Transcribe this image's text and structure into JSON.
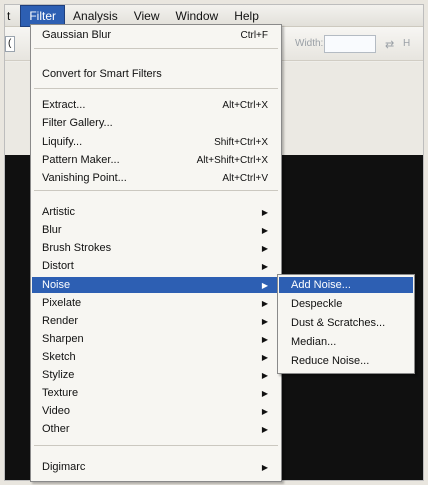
{
  "menubar": {
    "left_cut": "t",
    "items": [
      "Filter",
      "Analysis",
      "View",
      "Window",
      "Help"
    ],
    "active_index": 0
  },
  "optbar": {
    "left_cut": "(",
    "width_label": "Width:",
    "swap_glyph": "⇄",
    "right_cut": "H"
  },
  "menu": {
    "gaussian_blur": {
      "label": "Gaussian Blur",
      "shortcut": "Ctrl+F"
    },
    "convert_smart": {
      "label": "Convert for Smart Filters"
    },
    "extract": {
      "label": "Extract...",
      "shortcut": "Alt+Ctrl+X"
    },
    "filter_gallery": {
      "label": "Filter Gallery..."
    },
    "liquify": {
      "label": "Liquify...",
      "shortcut": "Shift+Ctrl+X"
    },
    "pattern_maker": {
      "label": "Pattern Maker...",
      "shortcut": "Alt+Shift+Ctrl+X"
    },
    "vanishing_point": {
      "label": "Vanishing Point...",
      "shortcut": "Alt+Ctrl+V"
    },
    "artistic": {
      "label": "Artistic"
    },
    "blur": {
      "label": "Blur"
    },
    "brush_strokes": {
      "label": "Brush Strokes"
    },
    "distort": {
      "label": "Distort"
    },
    "noise": {
      "label": "Noise"
    },
    "pixelate": {
      "label": "Pixelate"
    },
    "render": {
      "label": "Render"
    },
    "sharpen": {
      "label": "Sharpen"
    },
    "sketch": {
      "label": "Sketch"
    },
    "stylize": {
      "label": "Stylize"
    },
    "texture": {
      "label": "Texture"
    },
    "video": {
      "label": "Video"
    },
    "other": {
      "label": "Other"
    },
    "digimarc": {
      "label": "Digimarc"
    },
    "submenu_arrow": "▶"
  },
  "noise_submenu": {
    "add_noise": "Add Noise...",
    "despeckle": "Despeckle",
    "dust_scratches": "Dust & Scratches...",
    "median": "Median...",
    "reduce_noise": "Reduce Noise..."
  },
  "colors": {
    "highlight": "#2d5fb3",
    "menu_bg": "#f7f6f2",
    "canvas": "#101010"
  }
}
